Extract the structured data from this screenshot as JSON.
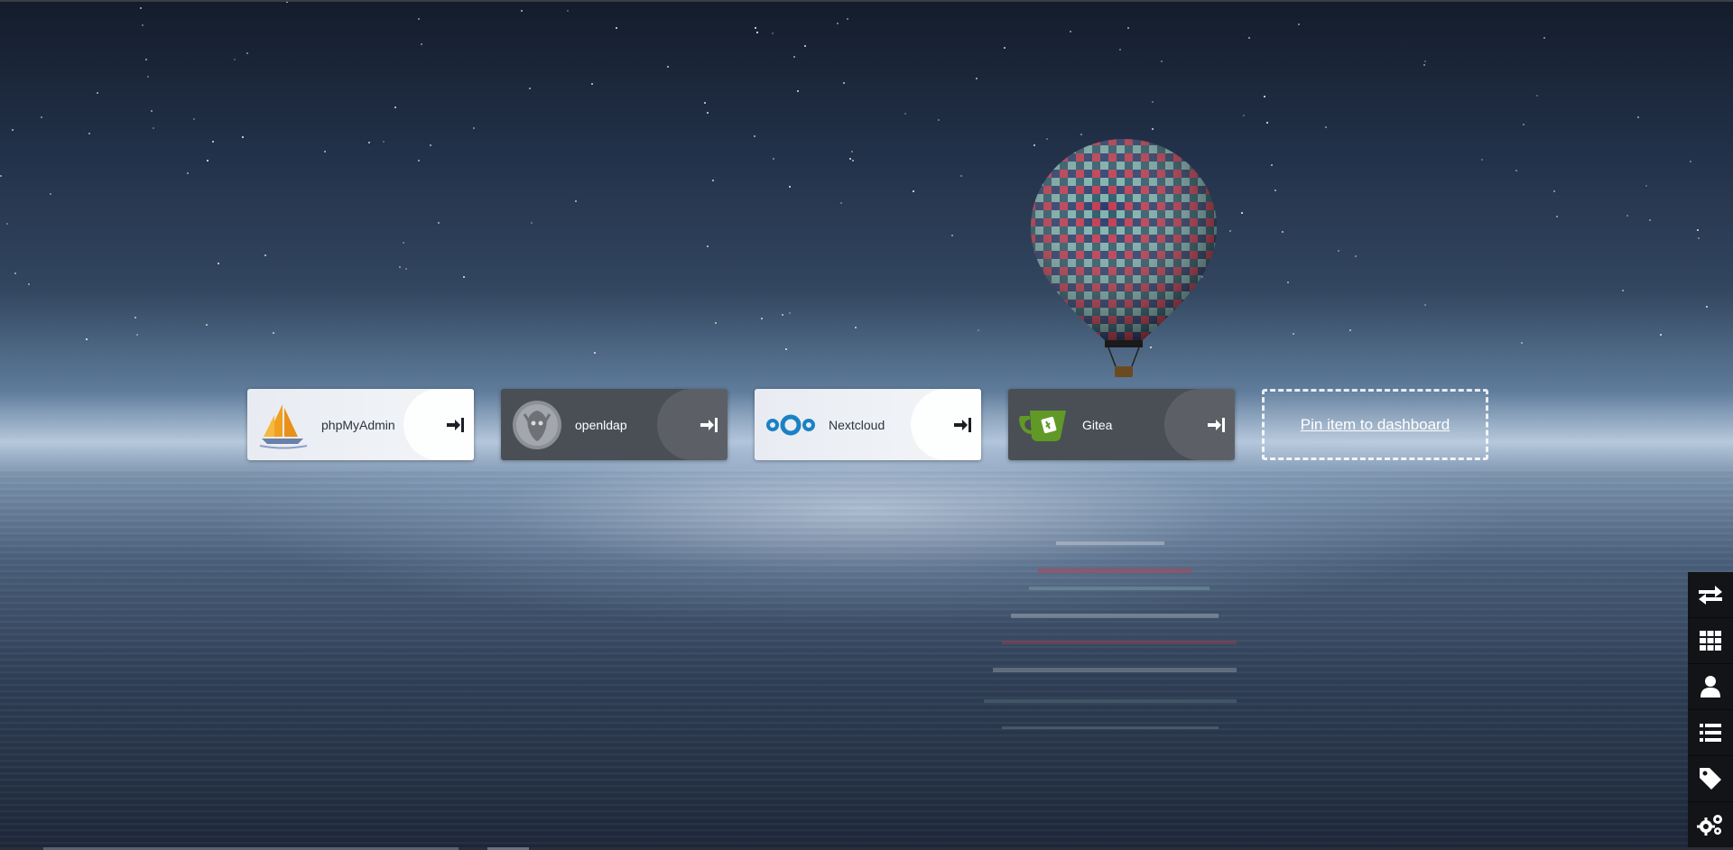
{
  "tiles": [
    {
      "name": "phpMyAdmin",
      "theme": "light",
      "icon": "sailboat-icon"
    },
    {
      "name": "openldap",
      "theme": "dark",
      "icon": "openldap-owl-icon"
    },
    {
      "name": "Nextcloud",
      "theme": "light",
      "icon": "nextcloud-icon"
    },
    {
      "name": "Gitea",
      "theme": "dark",
      "icon": "gitea-teacup-icon"
    }
  ],
  "pin": {
    "label": "Pin item to dashboard"
  },
  "sidebar": {
    "items": [
      {
        "icon": "switch-arrows-icon"
      },
      {
        "icon": "grid-icon"
      },
      {
        "icon": "user-icon"
      },
      {
        "icon": "list-icon"
      },
      {
        "icon": "tag-icon"
      },
      {
        "icon": "gears-icon"
      }
    ]
  },
  "colors": {
    "accent_nextcloud": "#1a82c4",
    "accent_gitea": "#609926",
    "tile_light": "#eef1f5",
    "tile_dark": "#4a4f55",
    "sidebar": "#121417"
  }
}
